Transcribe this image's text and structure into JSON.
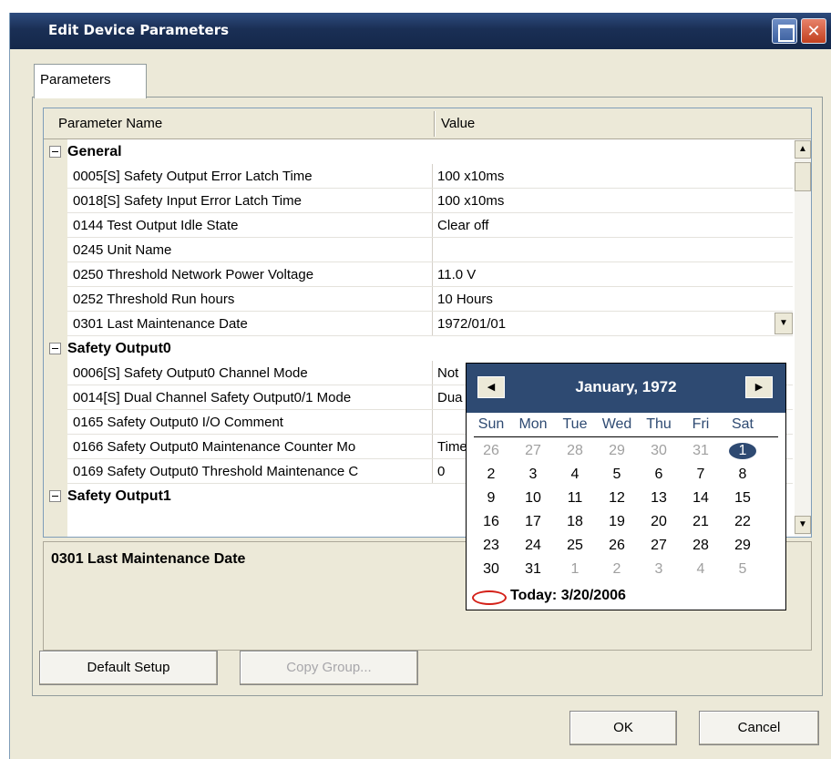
{
  "window": {
    "title": "Edit Device Parameters"
  },
  "tabs": [
    {
      "label": "Parameters"
    }
  ],
  "grid": {
    "columns": [
      "Parameter Name",
      "Value"
    ],
    "groups": [
      {
        "name": "General",
        "expander": "−",
        "rows": [
          {
            "name": "0005[S] Safety Output Error Latch Time",
            "value": "100 x10ms"
          },
          {
            "name": "0018[S] Safety Input Error Latch Time",
            "value": "100 x10ms"
          },
          {
            "name": "0144 Test Output Idle State",
            "value": "Clear off"
          },
          {
            "name": "0245 Unit Name",
            "value": ""
          },
          {
            "name": "0250 Threshold Network Power Voltage",
            "value": "11.0 V"
          },
          {
            "name": "0252 Threshold Run hours",
            "value": "10 Hours"
          },
          {
            "name": "0301 Last Maintenance Date",
            "value": "1972/01/01"
          }
        ]
      },
      {
        "name": "Safety Output0",
        "expander": "−",
        "rows": [
          {
            "name": "0006[S] Safety Output0 Channel Mode",
            "value": "Not"
          },
          {
            "name": "0014[S] Dual Channel Safety Output0/1 Mode",
            "value": "Dua"
          },
          {
            "name": "0165 Safety Output0 I/O Comment",
            "value": ""
          },
          {
            "name": "0166 Safety Output0 Maintenance Counter Mo",
            "value": "Time"
          },
          {
            "name": "0169 Safety Output0 Threshold Maintenance C",
            "value": "0"
          }
        ]
      },
      {
        "name": "Safety Output1",
        "expander": "−",
        "rows": []
      }
    ]
  },
  "description": {
    "title": "0301 Last Maintenance Date"
  },
  "buttons": {
    "default_setup": "Default Setup",
    "copy_group": "Copy Group...",
    "ok": "OK",
    "cancel": "Cancel"
  },
  "calendar": {
    "month_label": "January, 1972",
    "weekdays": [
      "Sun",
      "Mon",
      "Tue",
      "Wed",
      "Thu",
      "Fri",
      "Sat"
    ],
    "weeks": [
      [
        "26",
        "27",
        "28",
        "29",
        "30",
        "31",
        "1"
      ],
      [
        "2",
        "3",
        "4",
        "5",
        "6",
        "7",
        "8"
      ],
      [
        "9",
        "10",
        "11",
        "12",
        "13",
        "14",
        "15"
      ],
      [
        "16",
        "17",
        "18",
        "19",
        "20",
        "21",
        "22"
      ],
      [
        "23",
        "24",
        "25",
        "26",
        "27",
        "28",
        "29"
      ],
      [
        "30",
        "31",
        "1",
        "2",
        "3",
        "4",
        "5"
      ]
    ],
    "selected_day": "1",
    "today_label": "Today: 3/20/2006"
  },
  "icons": {
    "prev": "triangle-left-icon",
    "next": "triangle-right-icon",
    "dropdown": "chevron-down-icon",
    "scroll_up": "triangle-up-icon",
    "scroll_down": "triangle-down-icon"
  },
  "colors": {
    "titlebar": "#1a2f55",
    "calendar_header": "#2e4a72",
    "today_circle": "#d42018",
    "dialog_face": "#ece9d8"
  }
}
